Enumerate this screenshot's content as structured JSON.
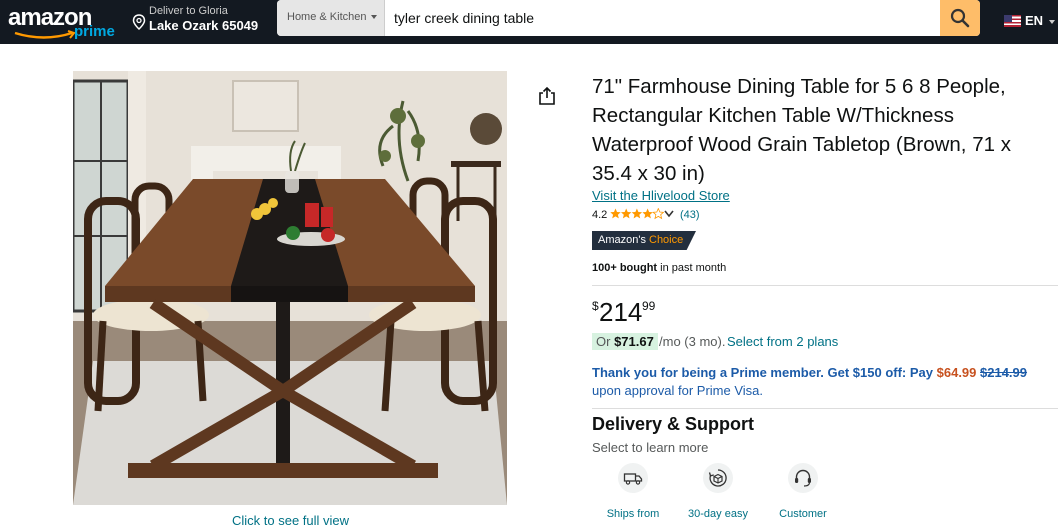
{
  "header": {
    "logo_text": "amazon",
    "logo_prime": "prime",
    "deliver_line1": "Deliver to Gloria",
    "deliver_line2": "Lake Ozark 65049",
    "search_category": "Home & Kitchen",
    "search_value": "tyler creek dining table",
    "language": "EN"
  },
  "gallery": {
    "click_full_view": "Click to see full view"
  },
  "product": {
    "title": "71\" Farmhouse Dining Table for 5 6 8 People, Rectangular Kitchen Table W/Thickness Waterproof Wood Grain Tabletop (Brown, 71 x 35.4 x 30 in)",
    "store_link": "Visit the Hlivelood Store",
    "rating": "4.2",
    "rating_stars": 4.2,
    "rating_count": "(43)",
    "badge_part1": "Amazon's",
    "badge_part2": "Choice",
    "bought_bold": "100+ bought",
    "bought_rest": " in past month",
    "price_symbol": "$",
    "price_dollars": "214",
    "price_cents": "99",
    "monthly_or": "Or",
    "monthly_amount": "$71.67",
    "monthly_rest": "/mo (3 mo).",
    "monthly_link": "Select from 2 plans",
    "prime_offer_bold": "Thank you for being a Prime member. Get $150 off: Pay",
    "prime_offer_price": "$64.99",
    "prime_offer_strike": "$214.99",
    "prime_offer_rest": "upon approval for Prime Visa."
  },
  "delivery": {
    "heading": "Delivery & Support",
    "subheading": "Select to learn more",
    "features": [
      {
        "icon": "truck-icon",
        "label": "Ships from"
      },
      {
        "icon": "return-box-icon",
        "label": "30-day easy"
      },
      {
        "icon": "headset-icon",
        "label": "Customer"
      }
    ]
  },
  "colors": {
    "header_bg": "#131921",
    "search_button": "#febd69",
    "link": "#007185",
    "prime_blue": "#1c5ba8",
    "deal_red": "#c7511f",
    "star": "#f90"
  }
}
